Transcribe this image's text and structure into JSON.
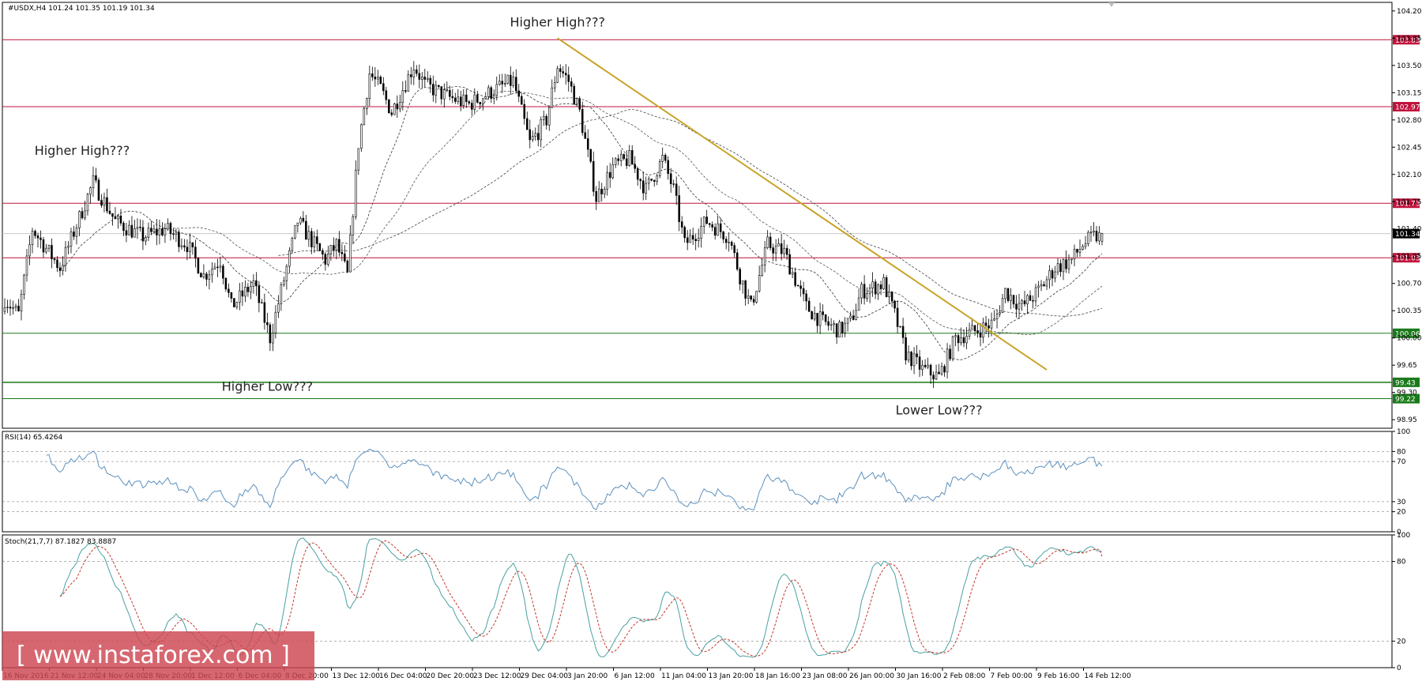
{
  "chart_data": [
    {
      "type": "candlestick",
      "symbol_header": "#USDX,H4  101.24 101.35 101.19 101.34",
      "ylim": [
        98.84,
        104.31
      ],
      "y_ticks": [
        "104.20",
        "103.85",
        "103.50",
        "103.15",
        "102.80",
        "102.45",
        "102.10",
        "101.75",
        "101.40",
        "101.05",
        "100.70",
        "100.35",
        "100.00",
        "99.65",
        "99.30",
        "98.95"
      ],
      "x_labels": [
        "16 Nov 2016",
        "21 Nov 12:00",
        "24 Nov 04:00",
        "28 Nov 20:00",
        "1 Dec 12:00",
        "6 Dec 04:00",
        "8 Dec 20:00",
        "13 Dec 12:00",
        "16 Dec 04:00",
        "20 Dec 20:00",
        "23 Dec 12:00",
        "29 Dec 04:00",
        "3 Jan 20:00",
        "6 Jan 12:00",
        "11 Jan 04:00",
        "13 Jan 20:00",
        "18 Jan 16:00",
        "23 Jan 08:00",
        "26 Jan 00:00",
        "30 Jan 16:00",
        "2 Feb 08:00",
        "7 Feb 00:00",
        "9 Feb 16:00",
        "14 Feb 12:00"
      ],
      "horizontal_levels": [
        {
          "value": 103.83,
          "label": "103.83",
          "color": "#c0123c"
        },
        {
          "value": 102.97,
          "label": "102.97",
          "color": "#c0123c"
        },
        {
          "value": 101.73,
          "label": "101.73",
          "color": "#c0123c"
        },
        {
          "value": 101.03,
          "label": "101.03",
          "color": "#c0123c"
        },
        {
          "value": 100.06,
          "label": "100.06",
          "color": "#1a7a1a"
        },
        {
          "value": 99.43,
          "label": "99.43",
          "color": "#1a7a1a"
        },
        {
          "value": 99.22,
          "label": "99.22",
          "color": "#1a7a1a"
        }
      ],
      "current_price": {
        "value": 101.34,
        "label": "101.34"
      },
      "trendline": {
        "color": "#c8a428",
        "from": {
          "bar": 200,
          "value": 103.85
        },
        "to": {
          "bar": 377,
          "value": 99.59
        }
      },
      "annotations": [
        {
          "text": "Higher High???",
          "bar": 200,
          "value": 104.0
        },
        {
          "text": "Higher High???",
          "bar": 28,
          "value": 102.35
        },
        {
          "text": "Higher Low???",
          "bar": 95,
          "value": 99.32
        },
        {
          "text": "Lower Low???",
          "bar": 338,
          "value": 99.02
        }
      ],
      "ohlc_shape": {
        "bars": 398,
        "anchors": [
          [
            0,
            100.5
          ],
          [
            5,
            100.3
          ],
          [
            10,
            101.4
          ],
          [
            20,
            100.9
          ],
          [
            32,
            102.0
          ],
          [
            40,
            101.5
          ],
          [
            50,
            101.3
          ],
          [
            58,
            101.4
          ],
          [
            66,
            101.2
          ],
          [
            72,
            100.8
          ],
          [
            78,
            101.0
          ],
          [
            82,
            100.4
          ],
          [
            90,
            100.7
          ],
          [
            96,
            100.0
          ],
          [
            100,
            100.6
          ],
          [
            106,
            101.5
          ],
          [
            110,
            101.3
          ],
          [
            116,
            101.0
          ],
          [
            120,
            101.2
          ],
          [
            124,
            100.8
          ],
          [
            128,
            102.5
          ],
          [
            132,
            103.4
          ],
          [
            136,
            103.2
          ],
          [
            140,
            102.9
          ],
          [
            148,
            103.5
          ],
          [
            152,
            103.25
          ],
          [
            160,
            103.1
          ],
          [
            168,
            103.0
          ],
          [
            178,
            103.2
          ],
          [
            184,
            103.3
          ],
          [
            190,
            102.5
          ],
          [
            196,
            102.8
          ],
          [
            200,
            103.5
          ],
          [
            204,
            103.3
          ],
          [
            208,
            102.9
          ],
          [
            214,
            101.8
          ],
          [
            220,
            102.2
          ],
          [
            226,
            102.3
          ],
          [
            232,
            101.9
          ],
          [
            238,
            102.3
          ],
          [
            242,
            101.9
          ],
          [
            246,
            101.2
          ],
          [
            254,
            101.5
          ],
          [
            262,
            101.3
          ],
          [
            266,
            100.8
          ],
          [
            270,
            100.4
          ],
          [
            276,
            101.2
          ],
          [
            282,
            101.1
          ],
          [
            290,
            100.4
          ],
          [
            296,
            100.2
          ],
          [
            302,
            100.1
          ],
          [
            306,
            100.2
          ],
          [
            310,
            100.6
          ],
          [
            318,
            100.7
          ],
          [
            322,
            100.3
          ],
          [
            326,
            99.8
          ],
          [
            332,
            99.6
          ],
          [
            338,
            99.5
          ],
          [
            344,
            100.0
          ],
          [
            352,
            100.1
          ],
          [
            358,
            100.2
          ],
          [
            362,
            100.6
          ],
          [
            368,
            100.4
          ],
          [
            374,
            100.6
          ],
          [
            380,
            100.9
          ],
          [
            386,
            101.0
          ],
          [
            390,
            101.2
          ],
          [
            394,
            101.3
          ],
          [
            397,
            101.3
          ]
        ]
      }
    },
    {
      "type": "line",
      "title": "RSI(14) 65.4264",
      "ylim": [
        0,
        100
      ],
      "y_ticks": [
        "100",
        "80",
        "70",
        "30",
        "20",
        "0"
      ],
      "levels": [
        80,
        70,
        30,
        20
      ],
      "last_value": 65.4264,
      "color": "#5d90bd"
    },
    {
      "type": "line",
      "title": "Stoch(21,7,7) 87.1827 83.8887",
      "ylim": [
        0,
        100
      ],
      "y_ticks": [
        "100",
        "80",
        "20",
        "0"
      ],
      "levels": [
        80,
        20
      ],
      "series": [
        {
          "name": "main",
          "last_value": 87.1827,
          "color": "#4aa0a0"
        },
        {
          "name": "signal",
          "last_value": 83.8887,
          "color": "#c0392b"
        }
      ]
    }
  ],
  "watermark": "[ www.instaforex.com ]"
}
